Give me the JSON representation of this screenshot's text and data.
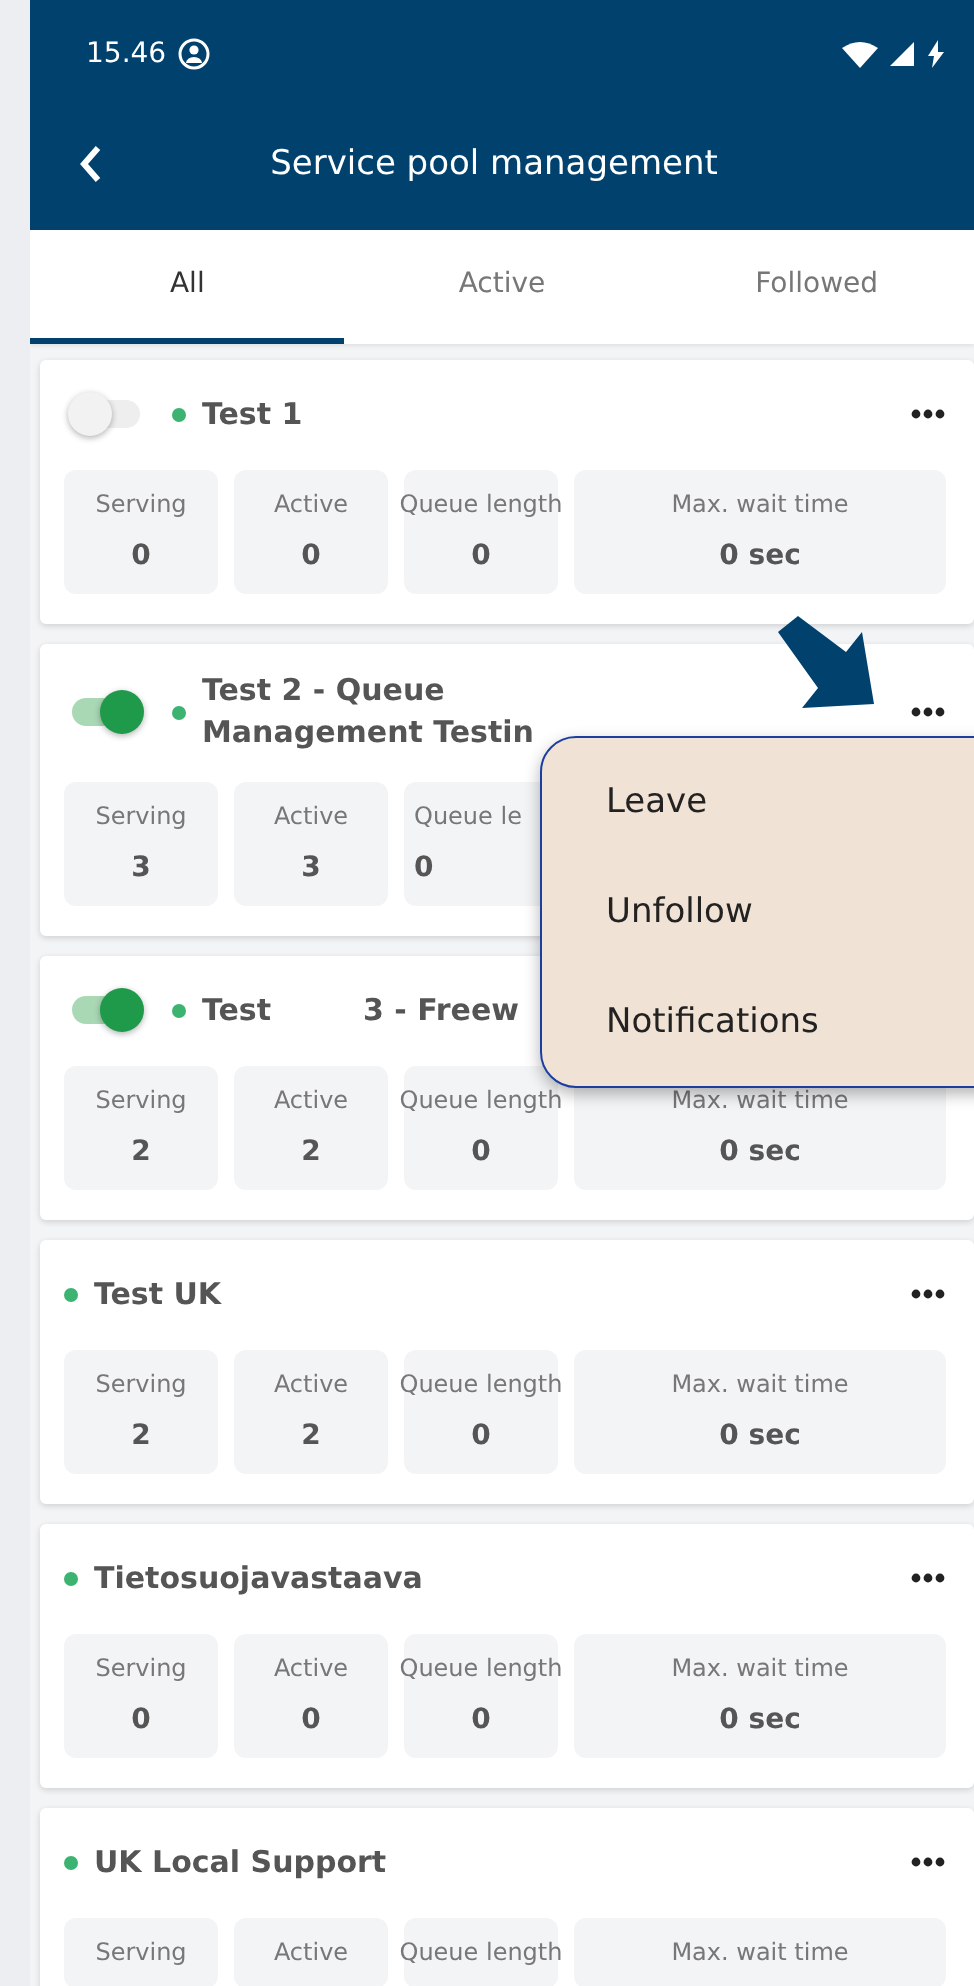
{
  "status_bar": {
    "time": "15.46"
  },
  "header": {
    "title": "Service pool management"
  },
  "tabs": [
    {
      "label": "All",
      "selected": true
    },
    {
      "label": "Active",
      "selected": false
    },
    {
      "label": "Followed",
      "selected": false
    }
  ],
  "pools": [
    {
      "title": "Test 1",
      "toggle": {
        "on": false
      },
      "color": "#3cb371",
      "stats": [
        {
          "label": "Serving",
          "value": "0",
          "kind": "full"
        },
        {
          "label": "Active",
          "value": "0",
          "kind": "full"
        },
        {
          "label": "Queue length",
          "value": "0",
          "kind": "full"
        },
        {
          "label": "Max. wait time",
          "value": "0 sec",
          "kind": "wide"
        }
      ]
    },
    {
      "title": "Test 2 - Queue Management Testin",
      "toggle": {
        "on": true
      },
      "color": "#3cb371",
      "stats": [
        {
          "label": "Serving",
          "value": "3",
          "kind": "full"
        },
        {
          "label": "Active",
          "value": "3",
          "kind": "full"
        },
        {
          "label": "Queue le",
          "value": "0",
          "kind": "partial"
        }
      ]
    },
    {
      "title": "Test",
      "title_2": "3 - Freew",
      "more_hidden": true,
      "toggle": {
        "on": true
      },
      "color": "#3cb371",
      "stats": [
        {
          "label": "Serving",
          "value": "2",
          "kind": "full"
        },
        {
          "label": "Active",
          "value": "2",
          "kind": "full"
        },
        {
          "label": "Queue length",
          "value": "0",
          "kind": "full"
        },
        {
          "label": "Max. wait time",
          "value": "0 sec",
          "kind": "wide"
        }
      ]
    },
    {
      "title": "Test UK",
      "color": "#3cb371",
      "stats": [
        {
          "label": "Serving",
          "value": "2",
          "kind": "full"
        },
        {
          "label": "Active",
          "value": "2",
          "kind": "full"
        },
        {
          "label": "Queue length",
          "value": "0",
          "kind": "full"
        },
        {
          "label": "Max. wait time",
          "value": "0 sec",
          "kind": "wide"
        }
      ]
    },
    {
      "title": "Tietosuojavastaava",
      "color": "#3cb371",
      "stats": [
        {
          "label": "Serving",
          "value": "0",
          "kind": "full"
        },
        {
          "label": "Active",
          "value": "0",
          "kind": "full"
        },
        {
          "label": "Queue length",
          "value": "0",
          "kind": "full"
        },
        {
          "label": "Max. wait time",
          "value": "0 sec",
          "kind": "wide"
        }
      ]
    },
    {
      "title": "UK Local Support",
      "color": "#3cb371",
      "stats": [
        {
          "label": "Serving",
          "kind": "full"
        },
        {
          "label": "Active",
          "kind": "full"
        },
        {
          "label": "Queue length",
          "kind": "full"
        },
        {
          "label": "Max. wait time",
          "kind": "wide"
        }
      ]
    }
  ],
  "menu": {
    "items": [
      "Leave",
      "Unfollow",
      "Notifications"
    ]
  }
}
